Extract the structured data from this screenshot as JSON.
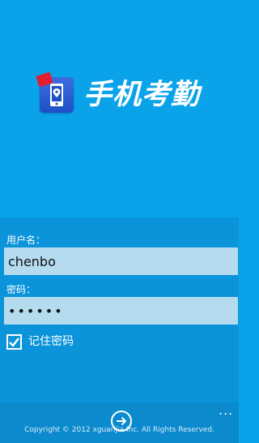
{
  "app": {
    "title": "手机考勤"
  },
  "login": {
    "username_label": "用户名：",
    "username_value": "chenbo",
    "password_label": "密码：",
    "password_value": "••••••",
    "remember_label": "记住密码",
    "remember_checked": true
  },
  "app_bar": {
    "more_label": "...",
    "copyright": "Copyright © 2012 xguanjia Inc. All Rights Reserved."
  },
  "colors": {
    "background": "#0aa3ea",
    "panel": "#0b94da",
    "input_bg": "#b4dcee",
    "app_bar": "#0b8ace"
  },
  "icons": {
    "logo": "phone-location-icon",
    "check": "checkmark-icon",
    "next": "arrow-right-circle-icon",
    "more": "ellipsis-icon"
  }
}
